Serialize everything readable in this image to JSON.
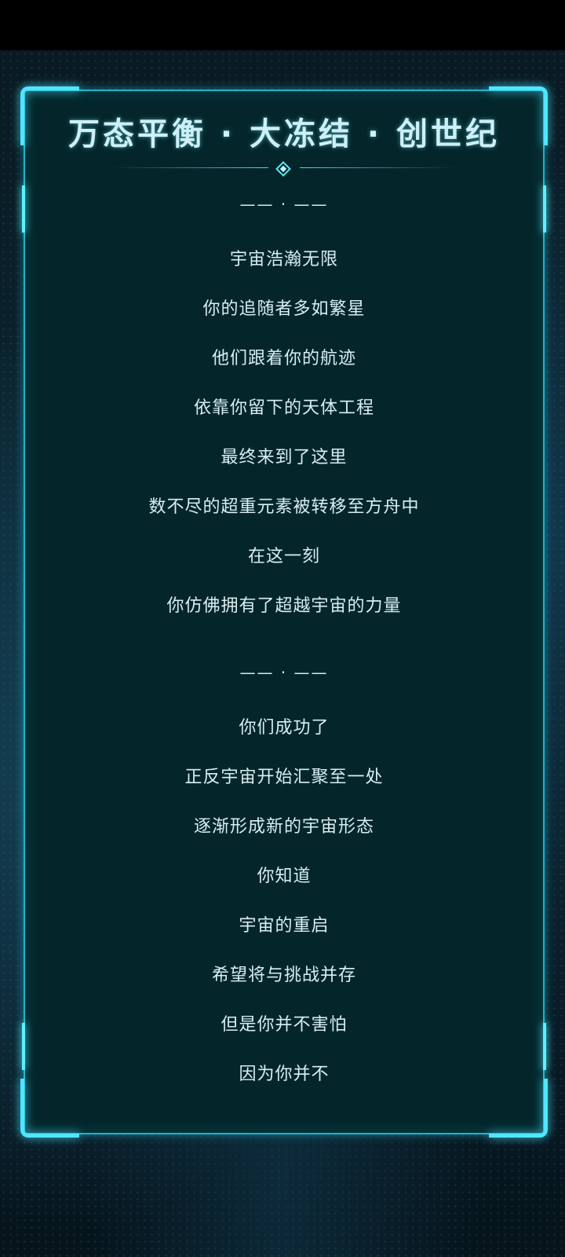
{
  "title": "万态平衡 · 大冻结 · 创世纪",
  "separator": "—— · ——",
  "section1": [
    "宇宙浩瀚无限",
    "你的追随者多如繁星",
    "他们跟着你的航迹",
    "依靠你留下的天体工程",
    "最终来到了这里",
    "数不尽的超重元素被转移至方舟中",
    "在这一刻",
    "你仿佛拥有了超越宇宙的力量"
  ],
  "section2": [
    "你们成功了",
    "正反宇宙开始汇聚至一处",
    "逐渐形成新的宇宙形态",
    "你知道",
    "宇宙的重启",
    "希望将与挑战并存",
    "但是你并不害怕",
    "因为你并不"
  ]
}
